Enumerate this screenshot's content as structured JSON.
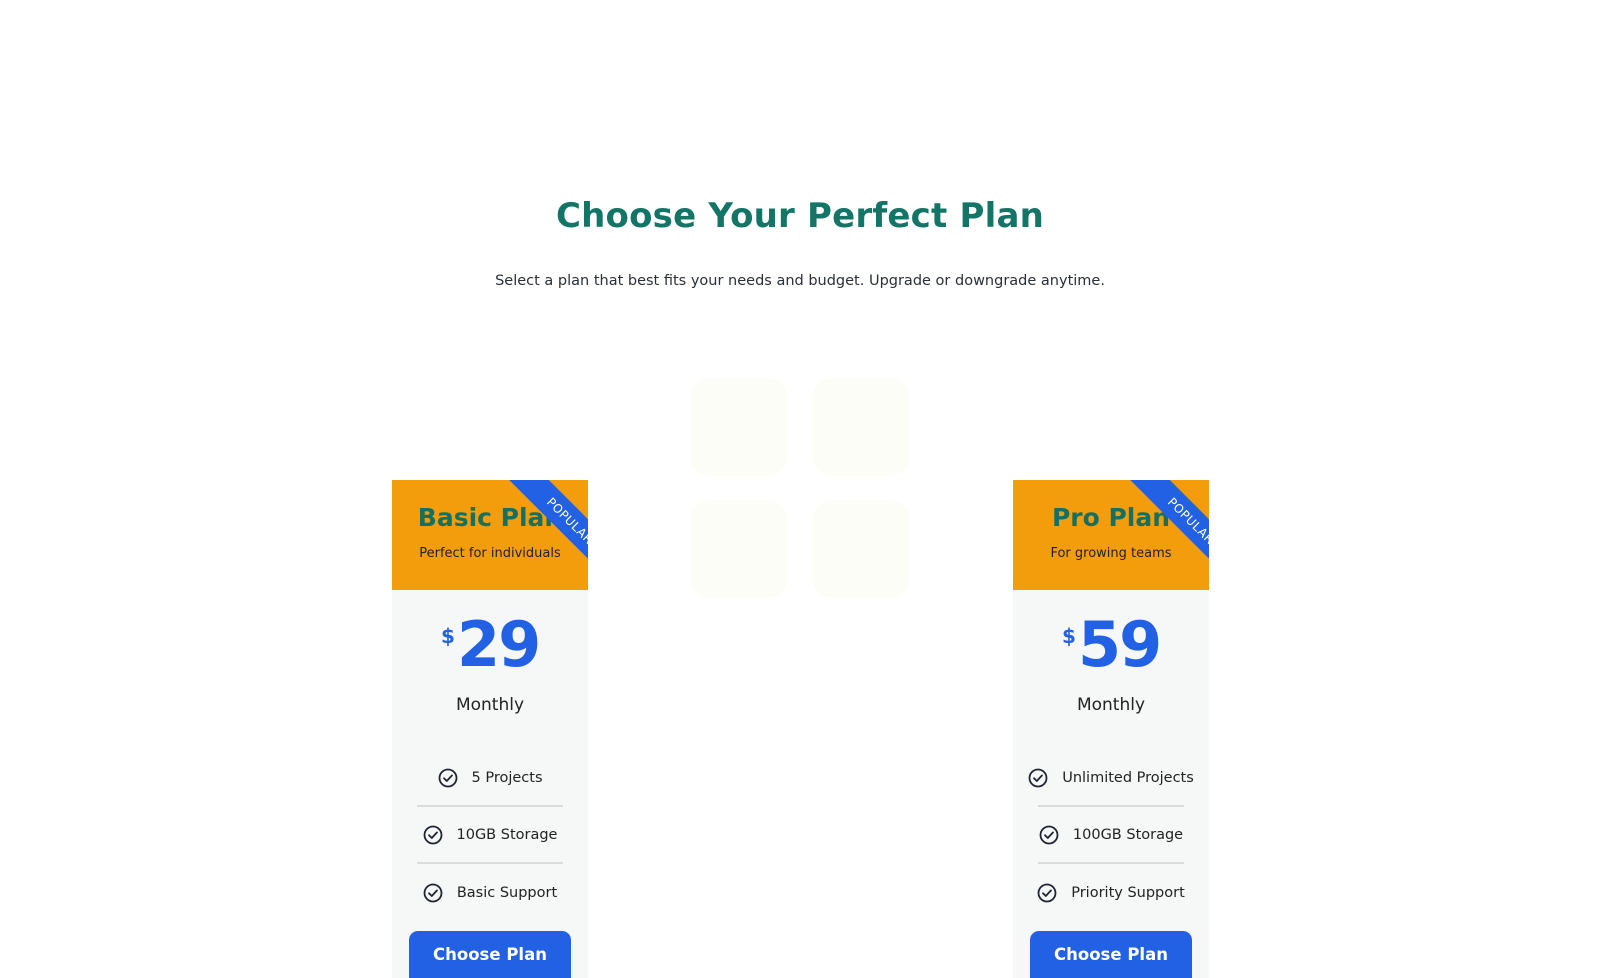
{
  "header": {
    "title": "Choose Your Perfect Plan",
    "subtitle": "Select a plan that best fits your needs and budget. Upgrade or downgrade anytime."
  },
  "plans": [
    {
      "name": "Basic Plan",
      "tagline": "Perfect for individuals",
      "badge": "POPULAR",
      "currency": "$",
      "price": "29",
      "period": "Monthly",
      "features": [
        "5 Projects",
        "10GB Storage",
        "Basic Support"
      ],
      "cta": "Choose Plan"
    },
    {
      "name": "Pro Plan",
      "tagline": "For growing teams",
      "badge": "POPULAR",
      "currency": "$",
      "price": "59",
      "period": "Monthly",
      "features": [
        "Unlimited Projects",
        "100GB Storage",
        "Priority Support"
      ],
      "cta": "Choose Plan"
    }
  ],
  "colors": {
    "title": "#127566",
    "header_bg": "#f49d0c",
    "accent": "#2361e4",
    "card_bg": "#f6f8f8"
  },
  "icons": {
    "feature": "check-circle-icon"
  }
}
